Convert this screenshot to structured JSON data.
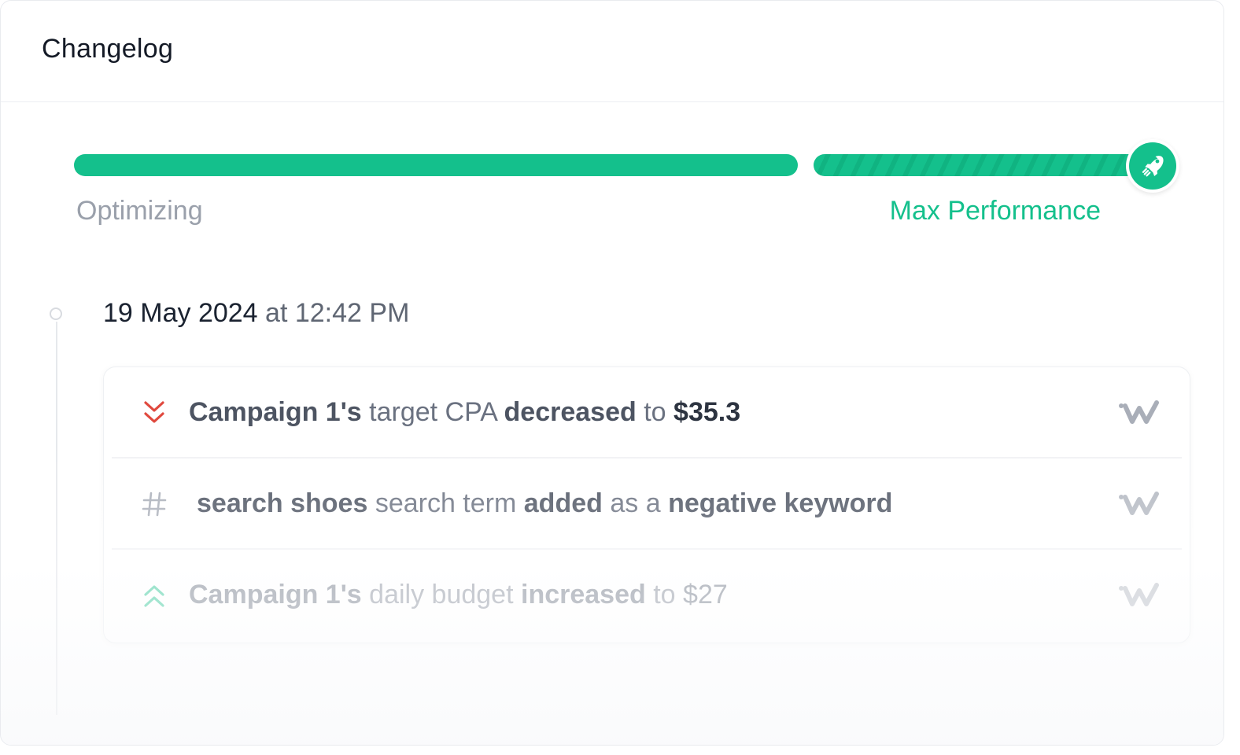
{
  "header": {
    "title": "Changelog"
  },
  "progress": {
    "stage_labels": [
      "Optimizing",
      "Max Performance"
    ],
    "active_stage": "Max Performance",
    "accent_color": "#14c08c",
    "badge_icon": "rocket-icon"
  },
  "timeline": {
    "entries": [
      {
        "date": "19 May 2024",
        "time_prefix": "at",
        "time": "12:42 PM",
        "changes": [
          {
            "icon": "chevrons-down-icon",
            "icon_color": "#e0493e",
            "parts": [
              "Campaign 1's",
              "target CPA",
              "decreased",
              "to",
              "$35.3"
            ],
            "brand_icon": "w-logo-icon"
          },
          {
            "icon": "hash-icon",
            "icon_color": "#9aa0ab",
            "parts": [
              "search shoes",
              "search term",
              "added",
              "as a",
              "negative keyword"
            ],
            "brand_icon": "w-logo-icon"
          },
          {
            "icon": "chevrons-up-icon",
            "icon_color": "#14c08c",
            "parts": [
              "Campaign 1's",
              "daily budget",
              "increased",
              "to",
              "$27"
            ],
            "brand_icon": "w-logo-icon"
          }
        ]
      }
    ]
  }
}
